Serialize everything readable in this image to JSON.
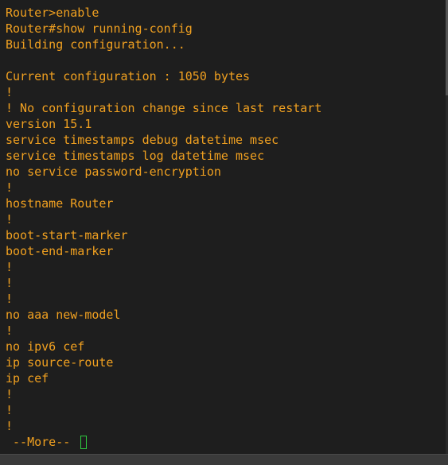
{
  "terminal": {
    "colors": {
      "background": "#1e1e1e",
      "text": "#f0a020",
      "cursor": "#2ecc40"
    },
    "lines": [
      "Router>enable",
      "Router#show running-config",
      "Building configuration...",
      "",
      "Current configuration : 1050 bytes",
      "!",
      "! No configuration change since last restart",
      "version 15.1",
      "service timestamps debug datetime msec",
      "service timestamps log datetime msec",
      "no service password-encryption",
      "!",
      "hostname Router",
      "!",
      "boot-start-marker",
      "boot-end-marker",
      "!",
      "!",
      "!",
      "no aaa new-model",
      "!",
      "no ipv6 cef",
      "ip source-route",
      "ip cef",
      "!",
      "!",
      "!"
    ],
    "pager_prompt": " --More-- "
  }
}
